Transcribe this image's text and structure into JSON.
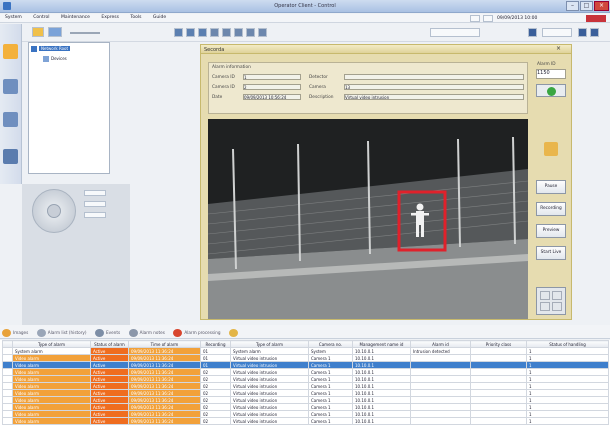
{
  "window": {
    "title": "Operator Client - Control"
  },
  "menu": {
    "items": [
      "System",
      "Control",
      "Maintenance",
      "Express",
      "Tools",
      "Guide"
    ]
  },
  "statusbar": {
    "datetime": "09/09/2013 10:00"
  },
  "tree": {
    "items": [
      {
        "label": "Network Root"
      },
      {
        "label": "Devices"
      }
    ]
  },
  "alarm_window": {
    "title": "Secorda",
    "info_header": "Alarm information",
    "labels": {
      "camera_id": "Camera ID",
      "camera_name": "Camera ID",
      "date": "Date",
      "detector": "Detector",
      "camera": "Camera",
      "description": "Description"
    },
    "values": {
      "camera_id": "1",
      "camera_name": "2",
      "date": "09/09/2013 10:56:24",
      "detector": "",
      "camera": "13",
      "description": "Virtual video intrusion"
    },
    "alarm_id_label": "Alarm ID",
    "alarm_id_value": "1150"
  },
  "right_buttons": [
    "Pause",
    "Recording",
    "Preview",
    "Start Live"
  ],
  "tabs": [
    "Images",
    "Alarm list (history)",
    "Events",
    "Alarm notes",
    "Alarm processing",
    ""
  ],
  "table": {
    "headers": [
      "",
      "Type of alarm",
      "Status of alarm",
      "Time of alarm",
      "Recording",
      "Type of alarm",
      "Camera no.",
      "Management name id",
      "Alarm id",
      "Priority class",
      "Status of handling"
    ],
    "rows": [
      [
        "",
        "System alarm",
        "Active",
        "09/09/2013 11:36:24",
        "01",
        "System alarm",
        "System",
        "10.10.0.1",
        "Intrusion detected",
        "",
        "1"
      ],
      [
        "",
        "Video alarm",
        "Active",
        "09/09/2013 11:36:24",
        "01",
        "Virtual video intrusion",
        "Camera 1",
        "10.10.0.1",
        "",
        "",
        "1"
      ],
      [
        "",
        "Video alarm",
        "Active",
        "09/09/2013 11:36:24",
        "01",
        "Virtual video intrusion",
        "Camera 1",
        "10.10.0.1",
        "",
        "",
        "1"
      ],
      [
        "",
        "Video alarm",
        "Active",
        "09/09/2013 11:36:24",
        "02",
        "Virtual video intrusion",
        "Camera 1",
        "10.10.0.1",
        "",
        "",
        "1"
      ],
      [
        "",
        "Video alarm",
        "Active",
        "09/09/2013 11:36:24",
        "02",
        "Virtual video intrusion",
        "Camera 1",
        "10.10.0.1",
        "",
        "",
        "1"
      ],
      [
        "",
        "Video alarm",
        "Active",
        "09/09/2013 11:36:24",
        "02",
        "Virtual video intrusion",
        "Camera 1",
        "10.10.0.1",
        "",
        "",
        "1"
      ],
      [
        "",
        "Video alarm",
        "Active",
        "09/09/2013 11:36:24",
        "02",
        "Virtual video intrusion",
        "Camera 1",
        "10.10.0.1",
        "",
        "",
        "1"
      ],
      [
        "",
        "Video alarm",
        "Active",
        "09/09/2013 11:36:24",
        "02",
        "Virtual video intrusion",
        "Camera 1",
        "10.10.0.1",
        "",
        "",
        "1"
      ],
      [
        "",
        "Video alarm",
        "Active",
        "09/09/2013 11:36:24",
        "02",
        "Virtual video intrusion",
        "Camera 1",
        "10.10.0.1",
        "",
        "",
        "1"
      ],
      [
        "",
        "Video alarm",
        "Active",
        "09/09/2013 11:36:24",
        "02",
        "Virtual video intrusion",
        "Camera 1",
        "10.10.0.1",
        "",
        "",
        "1"
      ],
      [
        "",
        "Video alarm",
        "Active",
        "09/09/2013 11:36:24",
        "02",
        "Virtual video intrusion",
        "Camera 1",
        "10.10.0.1",
        "",
        "",
        "1"
      ]
    ],
    "selected_row": 2
  },
  "colors": {
    "accent": "#3f7fcc",
    "alarm_orange": "#f2a13a",
    "detection_box": "#e0212b"
  }
}
